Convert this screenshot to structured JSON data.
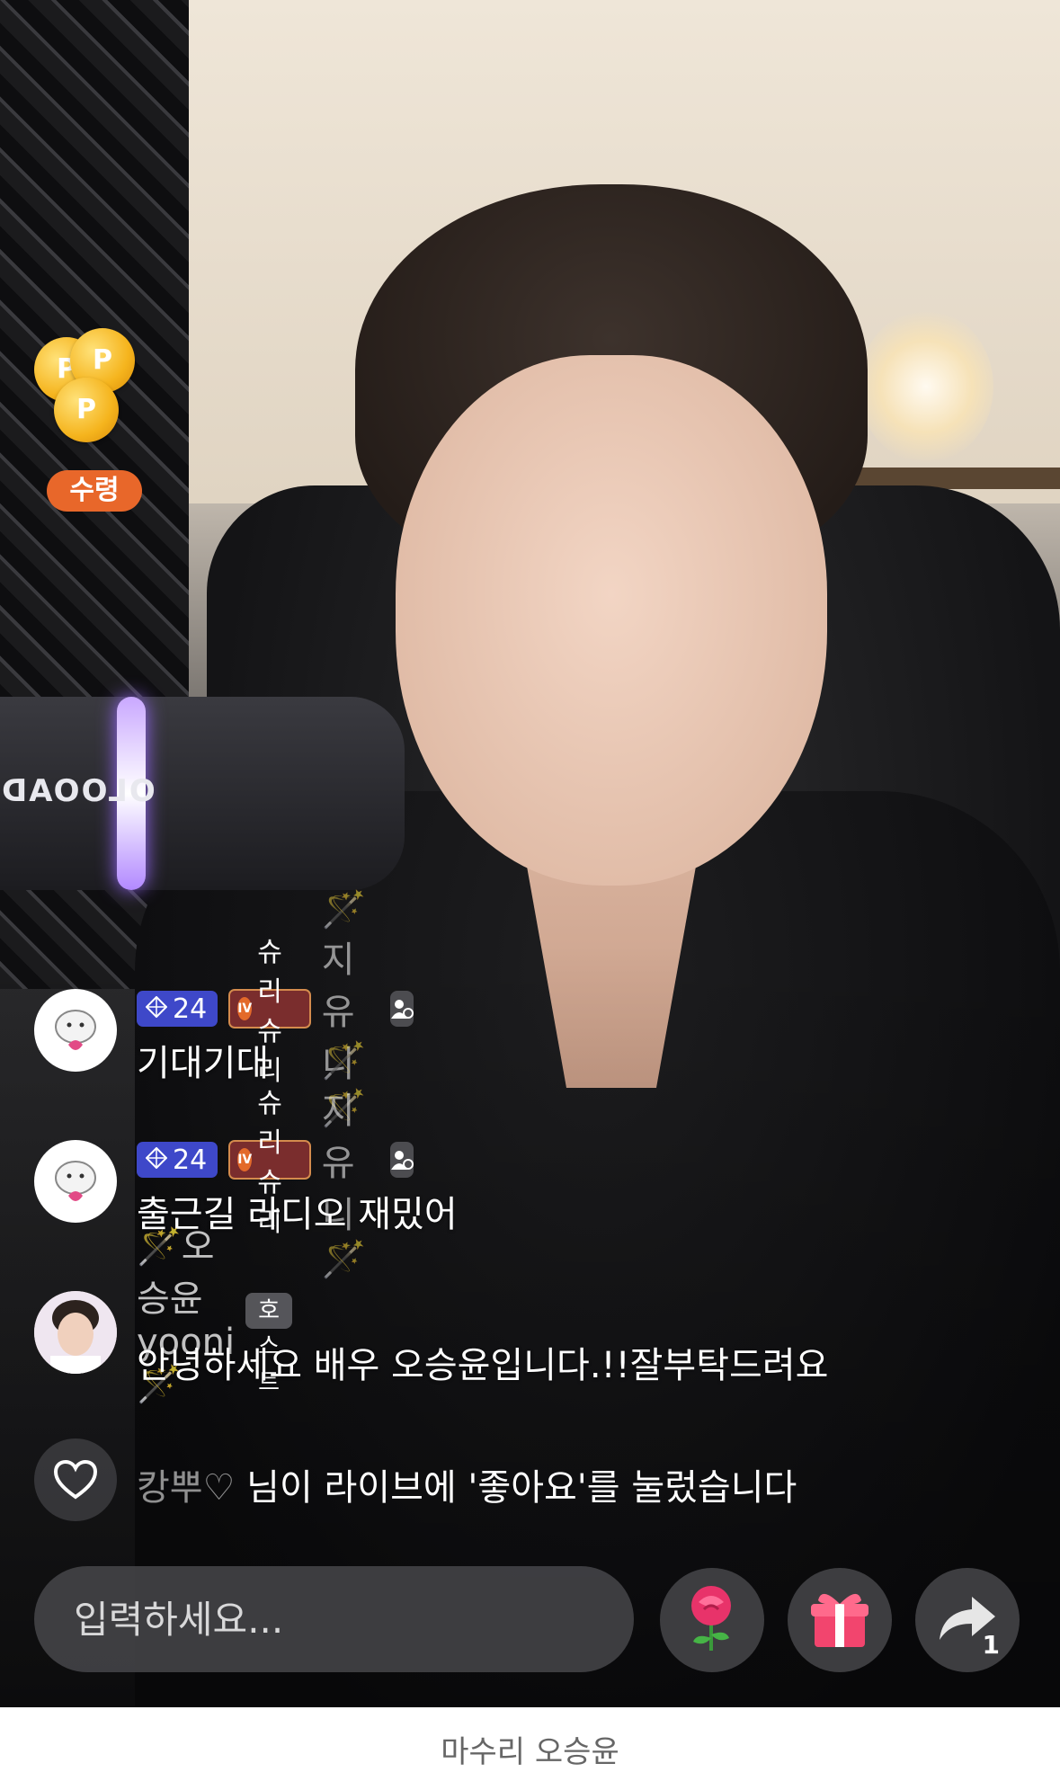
{
  "reward": {
    "label": "수령",
    "coin_letter": "P"
  },
  "background": {
    "mic_brand": "OLOOAD"
  },
  "chat": [
    {
      "level": "24",
      "club": "슈리슈리",
      "club_icon": "IV",
      "nickname": "🪄지유니🪄",
      "message": "기대기대"
    },
    {
      "level": "24",
      "club": "슈리슈리",
      "club_icon": "IV",
      "nickname": "🪄지유니🪄",
      "message": "출근길 라디오 재밌어"
    },
    {
      "nickname": "🪄오승윤yooni🪄",
      "tag": "호스트",
      "message": "안녕하세요 배우 오승윤입니다.!!잘부탁드려요"
    }
  ],
  "like_notice": {
    "user": "캉뿌♡",
    "text": " 님이 라이브에 '좋아요'를 눌렀습니다"
  },
  "input": {
    "placeholder": "입력하세요..."
  },
  "share": {
    "count": "1"
  },
  "footer": {
    "title": "마수리 오승윤"
  },
  "colors": {
    "level_badge": "#3e48c9",
    "club_badge": "#7a2d2d",
    "reward_label": "#e8672a"
  }
}
